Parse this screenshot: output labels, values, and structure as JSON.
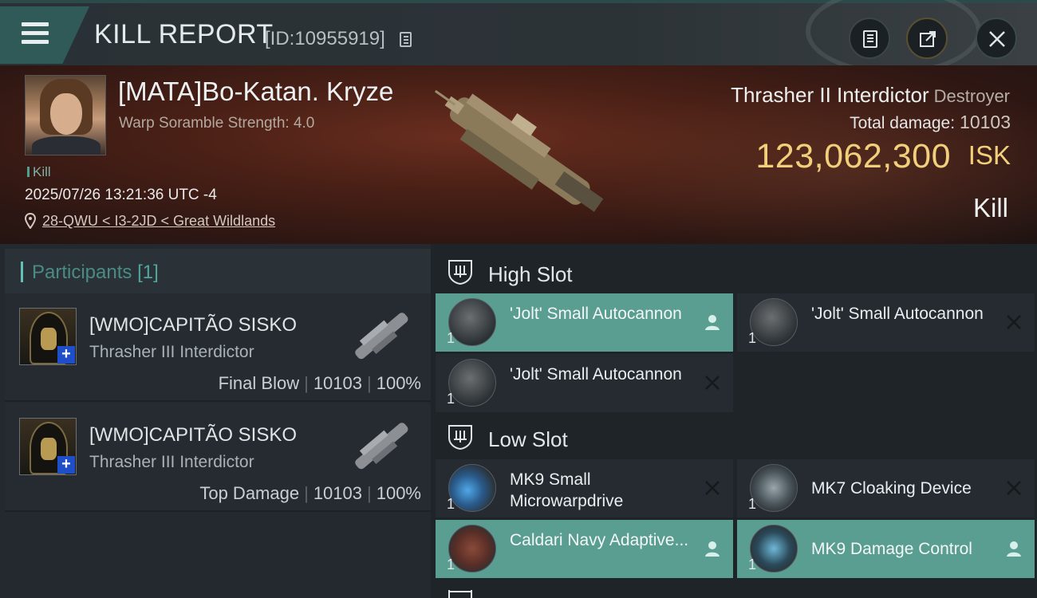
{
  "header": {
    "title": "KILL REPORT",
    "report_id": "[ID:10955919]"
  },
  "victim": {
    "name": "[MATA]Bo-Katan. Kryze",
    "scramble": "Warp Soramble Strength: 4.0",
    "tag": "Kill",
    "datetime": "2025/07/26 13:21:36 UTC -4",
    "location": "28-QWU < I3-2JD < Great Wildlands",
    "ship_type": "Thrasher II Interdictor",
    "ship_class": "Destroyer",
    "total_damage_label": "Total damage:",
    "total_damage": "10103",
    "isk_value": "123,062,300",
    "isk_label": "ISK",
    "result": "Kill"
  },
  "participants": {
    "label": "Participants",
    "count": "[1]",
    "rows": [
      {
        "name": "[WMO]CAPITÃO SISKO",
        "ship": "Thrasher III Interdictor",
        "role": "Final Blow",
        "damage": "10103",
        "percent": "100%"
      },
      {
        "name": "[WMO]CAPITÃO SISKO",
        "ship": "Thrasher III Interdictor",
        "role": "Top Damage",
        "damage": "10103",
        "percent": "100%"
      }
    ]
  },
  "slots": {
    "high": {
      "label": "High Slot",
      "modules": [
        {
          "name": "'Jolt' Small Autocannon",
          "qty": "1",
          "status": "dropped",
          "icon": "autocannon-icon"
        },
        {
          "name": "'Jolt' Small Autocannon",
          "qty": "1",
          "status": "destroyed",
          "icon": "autocannon-icon"
        },
        {
          "name": "'Jolt' Small Autocannon",
          "qty": "1",
          "status": "destroyed",
          "icon": "autocannon-icon"
        }
      ]
    },
    "low": {
      "label": "Low Slot",
      "modules": [
        {
          "name": "MK9 Small Microwarpdrive",
          "qty": "1",
          "status": "destroyed",
          "icon": "microwarpdrive-icon"
        },
        {
          "name": "MK7 Cloaking Device",
          "qty": "1",
          "status": "destroyed",
          "icon": "cloaking-device-icon"
        },
        {
          "name": "Caldari Navy Adaptive...",
          "qty": "1",
          "status": "dropped",
          "icon": "armor-plate-icon"
        },
        {
          "name": "MK9 Damage Control",
          "qty": "1",
          "status": "dropped",
          "icon": "damage-control-icon"
        }
      ]
    }
  },
  "colors": {
    "accent": "#5fc2b4",
    "dropped": "#5a9e92",
    "isk": "#f2cf7a"
  }
}
